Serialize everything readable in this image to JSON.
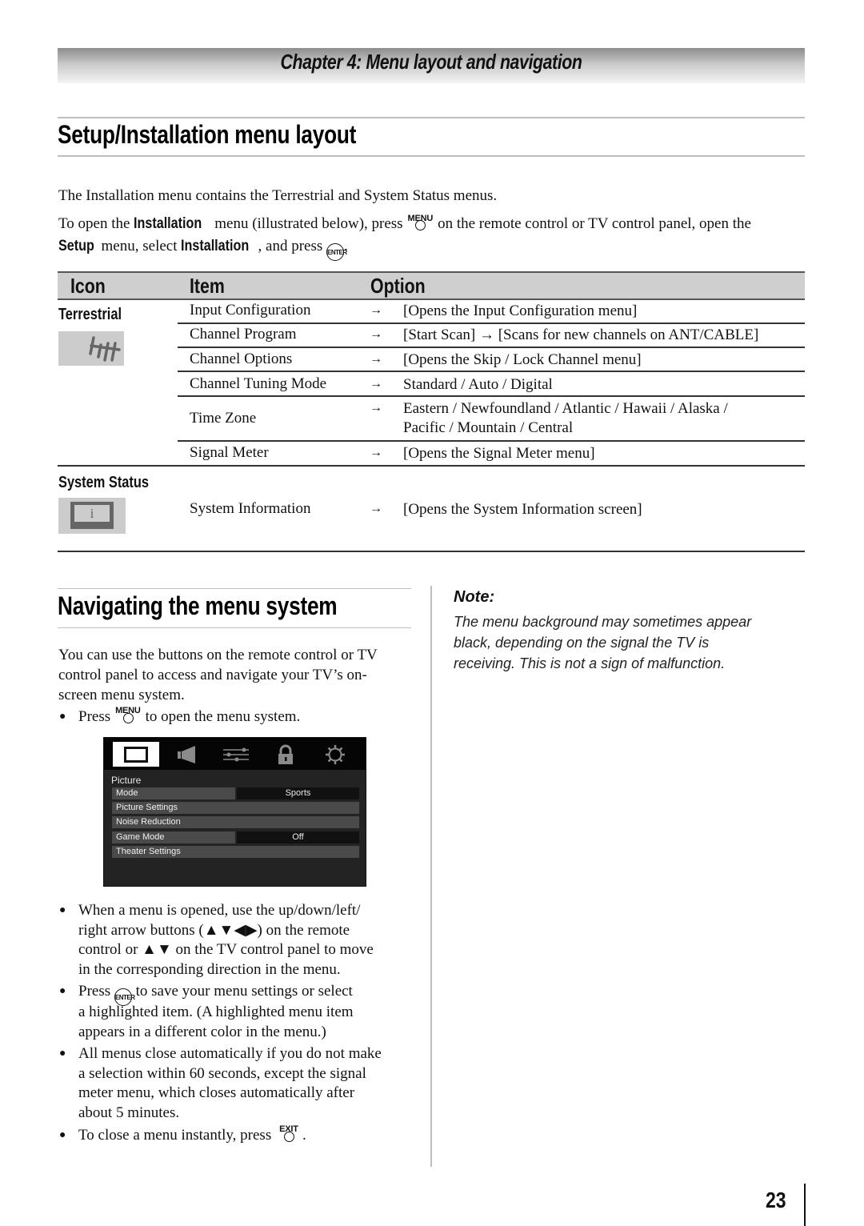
{
  "chapter": {
    "title": "Chapter 4: Menu layout and navigation"
  },
  "setup_section": {
    "heading": "Setup/Installation menu layout",
    "intro": "The Installation menu contains the Terrestrial and System Status menus.",
    "instructions": {
      "part1": "To open the ",
      "bold1": "Installation",
      "part2": " menu (illustrated below), press ",
      "menu_button_label": "MENU",
      "part3": " on the remote control or TV control panel, open the",
      "bold2": "Setup",
      "part4": " menu, select ",
      "bold3": "Installation",
      "part5": ", and press ",
      "enter_button_label": "ENTER",
      "part6": "."
    }
  },
  "table": {
    "headers": {
      "icon": "Icon",
      "item": "Item",
      "option": "Option"
    },
    "arrow": "→",
    "groups": [
      {
        "label": "Terrestrial",
        "icon": "antenna-icon",
        "rows": [
          {
            "item": "Input Configuration",
            "option": "[Opens the Input Configuration menu]"
          },
          {
            "item": "Channel Program",
            "option": "[Start Scan] → [Scans for new channels on ANT/CABLE]"
          },
          {
            "item": "Channel Options",
            "option": "[Opens the Skip / Lock Channel menu]"
          },
          {
            "item": "Channel Tuning Mode",
            "option": "Standard / Auto / Digital"
          },
          {
            "item": "Time Zone",
            "option_line1": "Eastern / Newfoundland / Atlantic / Hawaii / Alaska /",
            "option_line2": "Pacific / Mountain / Central"
          },
          {
            "item": "Signal Meter",
            "option": "[Opens the Signal Meter menu]"
          }
        ]
      },
      {
        "label": "System Status",
        "icon": "info-screen-icon",
        "icon_glyph": "i",
        "rows": [
          {
            "item": "System Information",
            "option": "[Opens the System Information screen]"
          }
        ]
      }
    ]
  },
  "nav_section": {
    "heading": "Navigating the menu system",
    "intro_line1": "You can use the buttons on the remote control or TV",
    "intro_line2": "control panel to access and navigate your TV’s on-",
    "intro_line3": "screen menu system.",
    "bullet1": {
      "pre": "Press ",
      "button": "MENU",
      "post": " to open the menu system."
    },
    "tv_menu": {
      "tabs": [
        "picture-tab",
        "sound-tab",
        "settings-tab",
        "lock-tab",
        "setup-tab"
      ],
      "active_tab": "picture-tab",
      "section_title": "Picture",
      "rows": [
        {
          "label": "Mode",
          "value": "Sports"
        },
        {
          "label": "Picture Settings"
        },
        {
          "label": "Noise Reduction"
        },
        {
          "label": "Game Mode",
          "value": "Off"
        },
        {
          "label": "Theater Settings"
        }
      ]
    },
    "bullet2": {
      "line1": "When a menu is opened, use the up/down/left/",
      "line2": "right arrow buttons (▲▼◀▶) on the remote",
      "line3": "control or ▲▼ on the TV control panel to move",
      "line4": "in the corresponding direction in the menu."
    },
    "bullet3": {
      "pre": "Press ",
      "button": "ENTER",
      "post": " to save your menu settings or select",
      "line2": "a highlighted item. (A highlighted menu item",
      "line3": "appears in a different color in the menu.)"
    },
    "bullet4": {
      "line1": "All menus close automatically if you do not make",
      "line2": "a selection within 60 seconds, except the signal",
      "line3": "meter menu, which closes automatically after",
      "line4": "about 5 minutes."
    },
    "bullet5": {
      "pre": "To close a menu instantly, press ",
      "button": "EXIT",
      "post": "."
    }
  },
  "note": {
    "title": "Note:",
    "line1": "The menu background may sometimes appear",
    "line2": "black, depending on the signal the TV is",
    "line3": "receiving. This is not a sign of malfunction."
  },
  "footer": {
    "page_number": "23"
  }
}
